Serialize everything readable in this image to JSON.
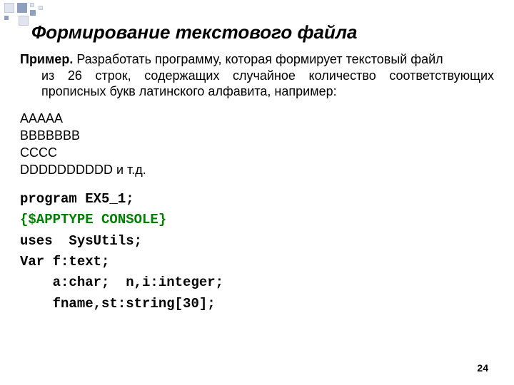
{
  "title": "Формирование текстового файла",
  "intro": {
    "label": "Пример.",
    "first_fragment": " Разработать программу, которая формирует текстовый файл",
    "rest": "из 26 строк, содержащих случайное количество соответствующих прописных букв латинского алфавита, например:"
  },
  "example": {
    "line1": "AAAAA",
    "line2": "BBBBBBB",
    "line3": "CCCC",
    "line4": "DDDDDDDDDD и т.д."
  },
  "code": {
    "l1_kw": "program",
    "l1_rest": " EX5_1;",
    "l2": "{$APPTYPE CONSOLE}",
    "l3_kw": "uses",
    "l3_rest": "  SysUtils;",
    "l4_kw": "Var",
    "l4_rest": " f:text;",
    "l5": "    a:char;  n,i:integer;",
    "l6": "    fname,st:string[30];"
  },
  "page_number": "24"
}
